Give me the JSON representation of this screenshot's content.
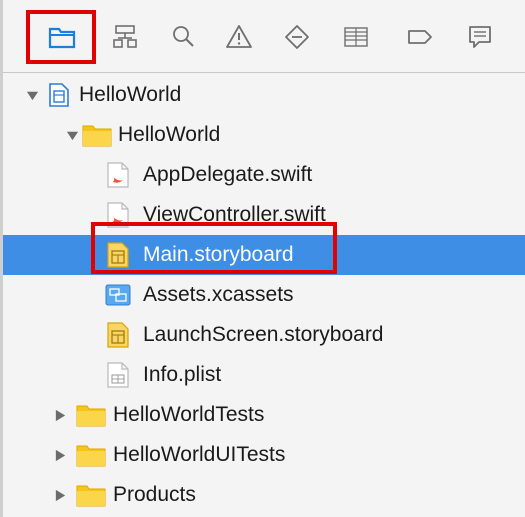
{
  "toolbar": {
    "icons": [
      {
        "name": "project-navigator-icon",
        "selected": true
      },
      {
        "name": "symbol-navigator-icon"
      },
      {
        "name": "find-navigator-icon"
      },
      {
        "name": "issue-navigator-icon"
      },
      {
        "name": "test-navigator-icon"
      },
      {
        "name": "debug-navigator-icon"
      },
      {
        "name": "breakpoint-navigator-icon"
      },
      {
        "name": "report-navigator-icon"
      }
    ]
  },
  "tree": {
    "project": {
      "label": "HelloWorld",
      "expanded": true,
      "icon": "project-file-icon"
    },
    "group": {
      "label": "HelloWorld",
      "expanded": true,
      "icon": "folder-icon"
    },
    "files": [
      {
        "label": "AppDelegate.swift",
        "icon": "swift-file-icon"
      },
      {
        "label": "ViewController.swift",
        "icon": "swift-file-icon"
      },
      {
        "label": "Main.storyboard",
        "icon": "storyboard-file-icon",
        "selected": true
      },
      {
        "label": "Assets.xcassets",
        "icon": "asset-catalog-icon"
      },
      {
        "label": "LaunchScreen.storyboard",
        "icon": "storyboard-file-icon"
      },
      {
        "label": "Info.plist",
        "icon": "plist-file-icon"
      }
    ],
    "collapsed_groups": [
      {
        "label": "HelloWorldTests",
        "icon": "folder-icon"
      },
      {
        "label": "HelloWorldUITests",
        "icon": "folder-icon"
      },
      {
        "label": "Products",
        "icon": "folder-icon"
      }
    ]
  },
  "colors": {
    "selection": "#3e8ee6",
    "folder": "#f5c518",
    "highlight_frame": "#e00000",
    "toolbar_selected": "#1a7fe0"
  }
}
